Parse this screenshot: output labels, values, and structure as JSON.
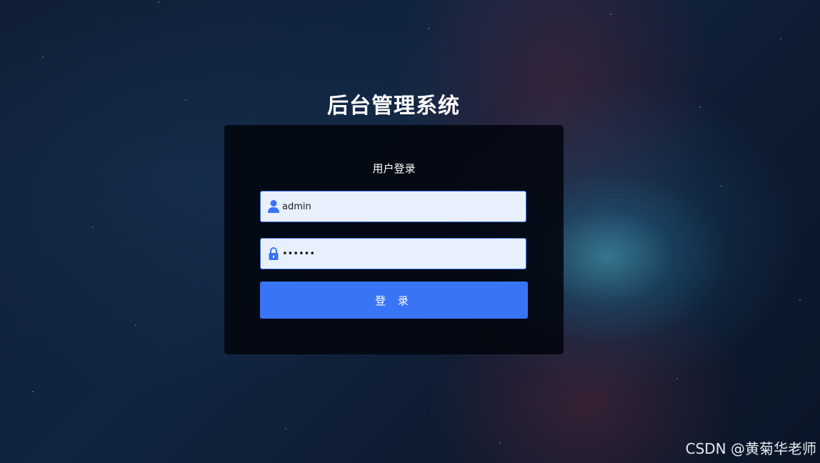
{
  "app": {
    "title": "后台管理系统"
  },
  "login_card": {
    "heading": "用户登录",
    "username": {
      "value": "admin",
      "icon": "user-icon"
    },
    "password": {
      "value": "••••••",
      "icon": "lock-icon"
    },
    "submit_label": "登 录"
  },
  "watermark": "CSDN @黄菊华老师",
  "colors": {
    "accent": "#3a74f6",
    "input_bg": "#e8f0fe",
    "input_border": "#3d6fe6",
    "card_bg": "#02060e"
  }
}
